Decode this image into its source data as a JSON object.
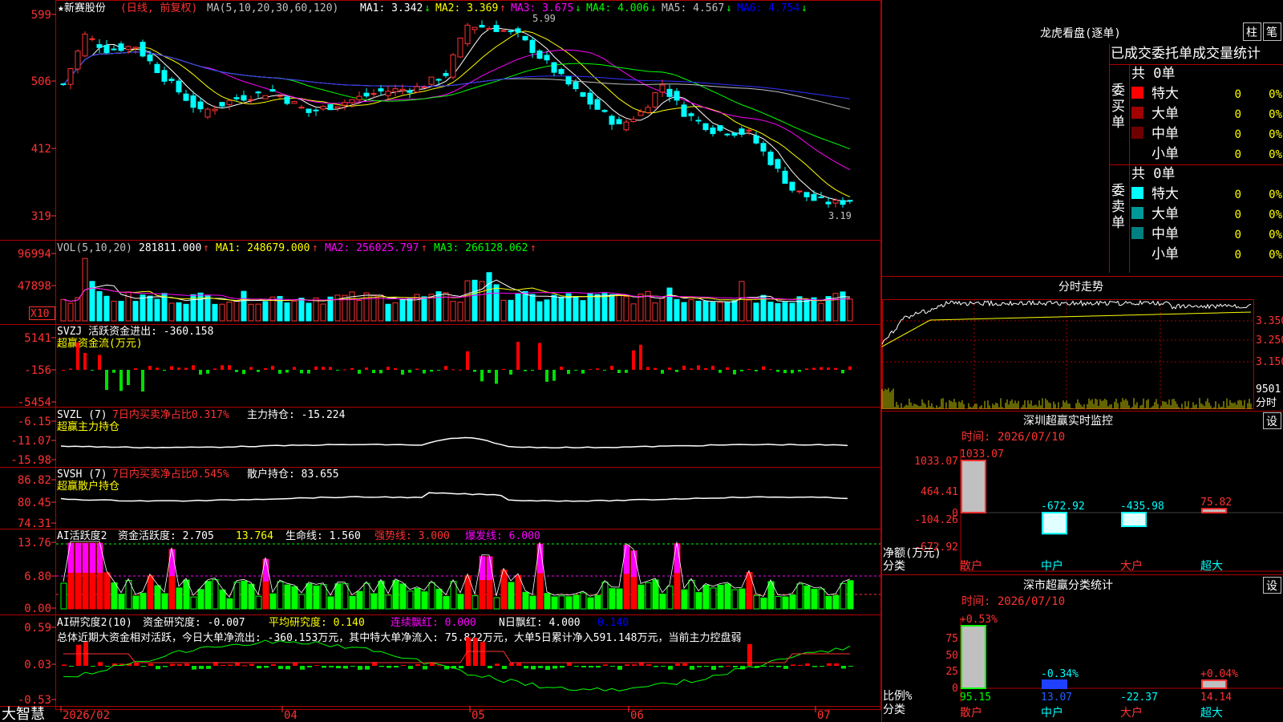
{
  "chart_meta": {
    "title": "★新赛股份",
    "period_label": "(日线, 前复权)",
    "ma_header": "MA(5,10,20,30,60,120)",
    "ma_values": [
      {
        "label": "MA1:",
        "value": "3.342",
        "arrow": "↓",
        "color": "#ffffff"
      },
      {
        "label": "MA2:",
        "value": "3.369",
        "arrow": "↑",
        "color": "#ffff00"
      },
      {
        "label": "MA3:",
        "value": "3.675",
        "arrow": "↓",
        "color": "#ff00ff"
      },
      {
        "label": "MA4:",
        "value": "4.006",
        "arrow": "↓",
        "color": "#00ff00"
      },
      {
        "label": "MA5:",
        "value": "4.567",
        "arrow": "↓",
        "color": "#c0c0c0"
      },
      {
        "label": "MA6:",
        "value": "4.754",
        "arrow": "↓",
        "color": "#0000ff"
      }
    ],
    "high_mark": "5.99",
    "low_mark": "3.19"
  },
  "price_axis": [
    "599",
    "506",
    "412",
    "319"
  ],
  "price_range": [
    2.9,
    6.1
  ],
  "volume_panel": {
    "header": "VOL(5,10,20)",
    "values": [
      {
        "label": "",
        "value": "281811.000",
        "arrow": "↑",
        "color": "#ffffff"
      },
      {
        "label": "MA1:",
        "value": "248679.000",
        "arrow": "↑",
        "color": "#ffff00"
      },
      {
        "label": "MA2:",
        "value": "256025.797",
        "arrow": "↑",
        "color": "#ff00ff"
      },
      {
        "label": "MA3:",
        "value": "266128.062",
        "arrow": "↑",
        "color": "#00ff00"
      }
    ],
    "axis": [
      "96994",
      "47898"
    ],
    "unit_tag": "X10"
  },
  "svzj_panel": {
    "line1": "SVZJ  活跃资金进出: -360.158",
    "line1_arrow": "↓",
    "line2": "超赢资金流(万元)",
    "axis": [
      "5141",
      "-156",
      "-5454"
    ]
  },
  "svzl_panel": {
    "name": "SVZL (7)",
    "ratio": "7日内买卖净占比0.317%",
    "holding": "主力持仓: -15.224",
    "arrow": "↓",
    "line2": "超赢主力持仓",
    "axis": [
      "-6.15",
      "-11.07",
      "-15.98"
    ]
  },
  "svsh_panel": {
    "name": "SVSH (7)",
    "ratio": "7日内买卖净占比0.545%",
    "holding": "散户持仓: 83.655",
    "arrow": "↑",
    "line2": "超赢散户持仓",
    "axis": [
      "86.82",
      "80.45",
      "74.31"
    ]
  },
  "ai_active_panel": {
    "name": "AI活跃度2",
    "v1": "资金活跃度: 2.705",
    "v2": "13.764",
    "v3": "生命线: 1.560",
    "v4": "强势线: 3.000",
    "v5": "爆发线: 6.000",
    "axis": [
      "13.76",
      "6.80",
      "0.00"
    ]
  },
  "ai_research_panel": {
    "name": "AI研究度2(10)",
    "v1": "资金研究度: -0.007",
    "v2": "平均研究度: 0.140",
    "v3": "连续飘红: 0.000",
    "v4": "N日飘红: 4.000",
    "v5": "0.140",
    "summary": "总体近期大资金相对活跃，今日大单净流出: -360.153万元，其中特大单净流入: 75.822万元，大单5日累计净入591.148万元，当前主力控盘弱",
    "axis": [
      "0.59",
      "0.03",
      "-0.53"
    ]
  },
  "date_axis": [
    "2026/02",
    "04",
    "05",
    "06",
    "07"
  ],
  "brand": "大智慧",
  "right_panel": {
    "dragon_title": "龙虎看盘(逐单)",
    "btn_zhu": "柱",
    "btn_bi": "笔",
    "subtitle": "已成交委托单成交量统计",
    "buy_label": "委买单",
    "sell_label": "委卖单",
    "buy_total": "共 0单",
    "sell_total": "共 0单",
    "rows": [
      {
        "name": "特大",
        "count": "0",
        "pct": "0%"
      },
      {
        "name": "大单",
        "count": "0",
        "pct": "0%"
      },
      {
        "name": "中单",
        "count": "0",
        "pct": "0%"
      },
      {
        "name": "小单",
        "count": "0",
        "pct": "0%"
      }
    ],
    "buy_colors": [
      "#ff0000",
      "#a00000",
      "#700000",
      ""
    ],
    "sell_colors": [
      "#00ffff",
      "#009999",
      "#008080",
      ""
    ],
    "intraday_title": "分时走势",
    "intraday_axis": [
      "3.350",
      "3.250",
      "3.150"
    ],
    "intraday_vol": "9501",
    "intraday_tag": "分时",
    "monitor_title": "深圳超赢实时监控",
    "set_btn": "设",
    "monitor_time": "时间: 2026/07/10",
    "monitor_axis": [
      "1033.07",
      "464.41",
      "0",
      "-104.26",
      "-672.92"
    ],
    "monitor_bars": [
      {
        "label": "1033.07",
        "value": 1033.07
      },
      {
        "label": "-672.92",
        "value": -672.92
      },
      {
        "label": "-435.98",
        "value": -435.98
      },
      {
        "label": "75.82",
        "value": 75.82
      }
    ],
    "monitor_y_title": "净额(万元)",
    "monitor_x_title": "分类",
    "categories": [
      "散户",
      "中户",
      "大户",
      "超大"
    ],
    "class_title": "深市超赢分类统计",
    "class_time": "时间: 2026/07/10",
    "class_axis": [
      "75",
      "50",
      "25",
      "0"
    ],
    "class_pcts": [
      "+0.53%",
      "-0.34%",
      "",
      "+0.04%"
    ],
    "class_values": [
      "95.15",
      "13.07",
      "-22.37",
      "14.14"
    ],
    "class_y_title": "比例%",
    "class_x_title": "分类"
  },
  "colors": {
    "up": "#ff3232",
    "down": "#00ffff",
    "frame": "#b00000",
    "label": "#ff3232"
  }
}
